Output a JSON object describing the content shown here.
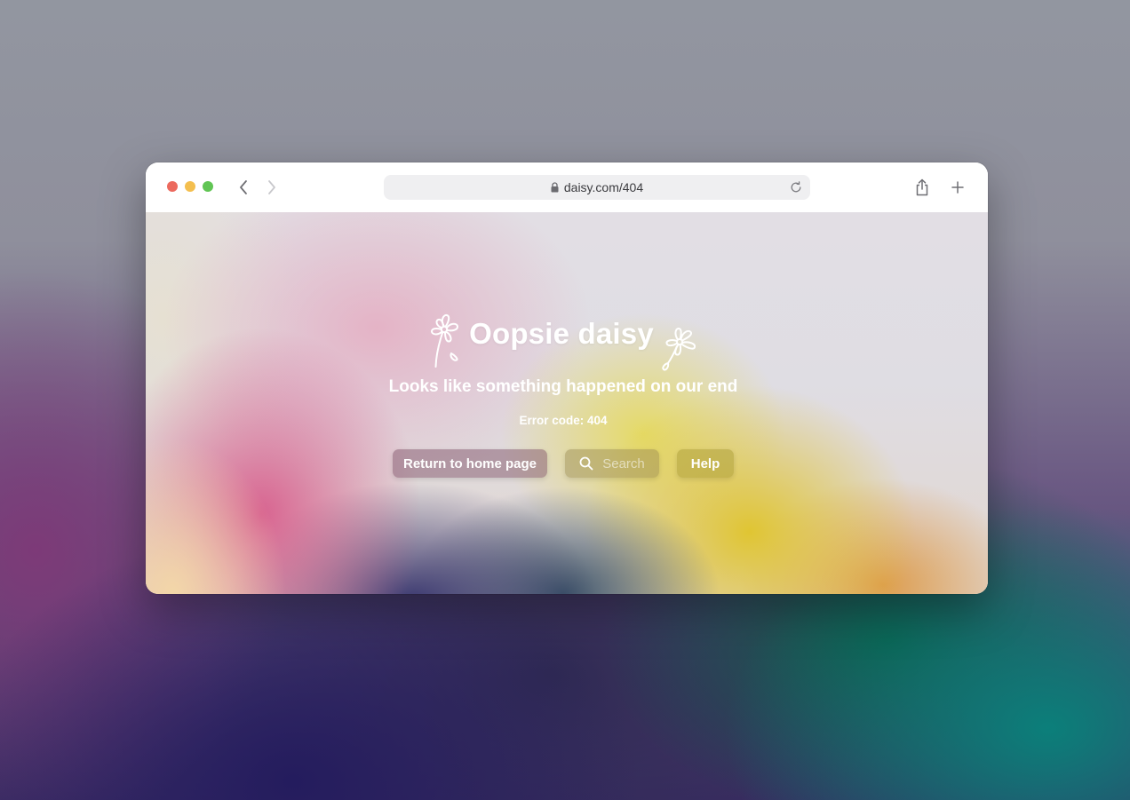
{
  "browser": {
    "url": "daisy.com/404",
    "icons": {
      "back": "chevron-left-icon",
      "forward": "chevron-right-icon",
      "lock": "lock-icon",
      "reload": "reload-icon",
      "share": "share-icon",
      "new_tab": "plus-icon"
    },
    "traffic_lights": {
      "close": "#ec6a5e",
      "minimize": "#f4bf4f",
      "maximize": "#61c554"
    }
  },
  "page": {
    "title": "Oopsie daisy",
    "subtitle": "Looks like something happened on our end",
    "error_code": "Error code: 404",
    "decorations": [
      "daisy-flower-left-icon",
      "daisy-flower-right-icon"
    ],
    "buttons": {
      "home": "Return to home page",
      "search": "Search",
      "help": "Help"
    }
  },
  "colors": {
    "text": "#ffffff",
    "toolbar_bg": "#ffffff",
    "url_bar_bg": "#efeff1"
  }
}
